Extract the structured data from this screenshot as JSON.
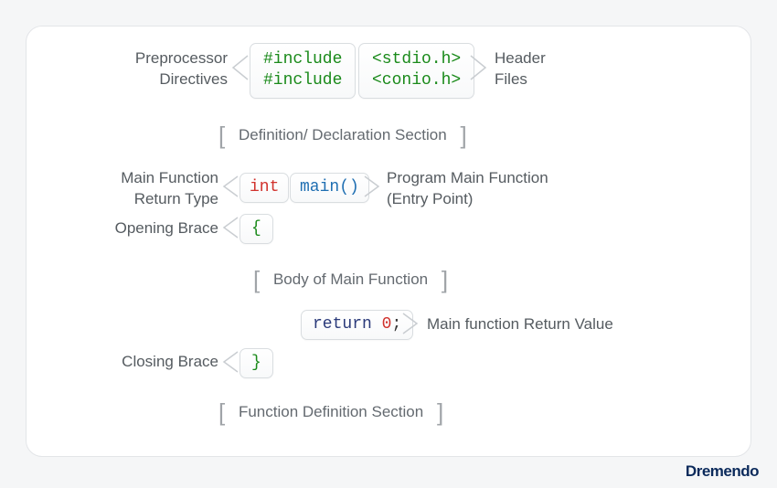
{
  "labels": {
    "preprocessor_l1": "Preprocessor",
    "preprocessor_l2": "Directives",
    "header_l1": "Header",
    "header_l2": "Files",
    "main_ret_l1": "Main Function",
    "main_ret_l2": "Return Type",
    "main_fn_l1": "Program Main Function",
    "main_fn_l2": "(Entry Point)",
    "opening_brace": "Opening Brace",
    "closing_brace": "Closing Brace",
    "return_value": "Main function Return Value"
  },
  "sections": {
    "definition": "Definition/ Declaration Section",
    "body": "Body of Main Function",
    "fn_def": "Function Definition Section"
  },
  "code": {
    "include1": "#include",
    "include2": "#include",
    "header1": "<stdio.h>",
    "header2": "<conio.h>",
    "int": "int",
    "main": "main()",
    "open_brace": "{",
    "close_brace": "}",
    "return": "return",
    "zero": "0",
    "semi": ";"
  },
  "brand": "Dremendo"
}
